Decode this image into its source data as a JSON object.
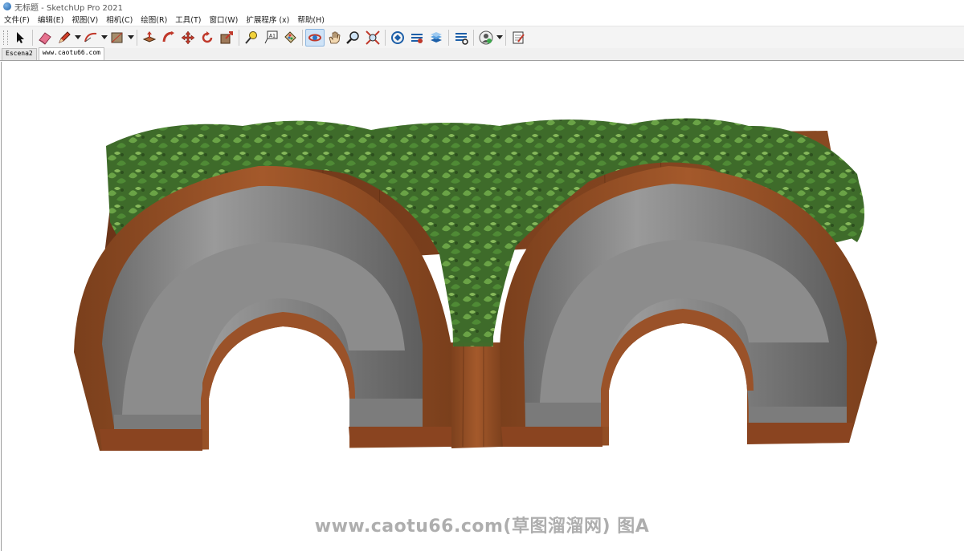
{
  "window": {
    "title": "无标题 - SketchUp Pro 2021"
  },
  "menu": {
    "items": [
      "文件(F)",
      "编辑(E)",
      "视图(V)",
      "相机(C)",
      "绘图(R)",
      "工具(T)",
      "窗口(W)",
      "扩展程序 (x)",
      "帮助(H)"
    ]
  },
  "toolbar": {
    "tools": [
      {
        "name": "select-tool",
        "icon": "arrow-cursor-icon"
      },
      {
        "name": "eraser-tool",
        "icon": "eraser-icon"
      },
      {
        "name": "line-tool",
        "icon": "pencil-icon"
      },
      {
        "name": "arc-tool",
        "icon": "arc-icon"
      },
      {
        "name": "rectangle-tool",
        "icon": "rectangle-icon"
      },
      {
        "name": "push-pull-tool",
        "icon": "push-pull-icon"
      },
      {
        "name": "follow-me-tool",
        "icon": "follow-me-icon"
      },
      {
        "name": "move-tool",
        "icon": "move-icon"
      },
      {
        "name": "rotate-tool",
        "icon": "rotate-icon"
      },
      {
        "name": "scale-tool",
        "icon": "scale-icon"
      },
      {
        "name": "tape-measure-tool",
        "icon": "tape-measure-icon"
      },
      {
        "name": "text-tool",
        "icon": "text-icon"
      },
      {
        "name": "paint-bucket-tool",
        "icon": "paint-bucket-icon"
      },
      {
        "name": "orbit-tool",
        "icon": "orbit-icon"
      },
      {
        "name": "pan-tool",
        "icon": "hand-icon"
      },
      {
        "name": "zoom-tool",
        "icon": "magnifier-icon"
      },
      {
        "name": "zoom-extents-tool",
        "icon": "zoom-extents-icon"
      },
      {
        "name": "warehouse-3d",
        "icon": "warehouse-icon"
      },
      {
        "name": "extension-warehouse",
        "icon": "extension-icon"
      },
      {
        "name": "layout-send",
        "icon": "layout-icon"
      },
      {
        "name": "extension-manager",
        "icon": "extension-manager-icon"
      },
      {
        "name": "account",
        "icon": "user-icon"
      },
      {
        "name": "notes",
        "icon": "notepad-icon"
      }
    ],
    "text_tool_glyph": "A1"
  },
  "tabs": [
    {
      "label": "Escena2",
      "active": false
    },
    {
      "label": "www.caotu66.com",
      "active": true
    }
  ],
  "viewport": {
    "watermark": "www.caotu66.com(草图溜溜网) 图A",
    "colors": {
      "wood": "#8a4a22",
      "wood_light": "#b76433",
      "concrete": "#8d8d8d",
      "concrete_dark": "#6a6a6a",
      "foliage": "#4f8a35"
    }
  }
}
